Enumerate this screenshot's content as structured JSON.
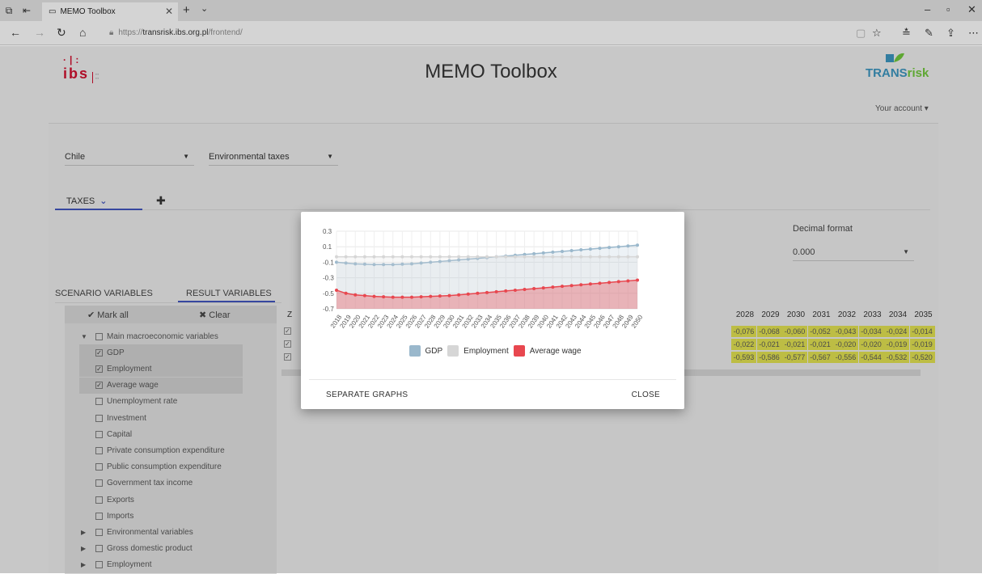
{
  "browser": {
    "tab_title": "MEMO Toolbox",
    "url_prefix": "https://",
    "url_host": "transrisk.ibs.org.pl",
    "url_path": "/frontend/"
  },
  "header": {
    "app_title": "MEMO Toolbox",
    "ibs_logo_text": "ibs",
    "trans_logo_left": "TRANS",
    "trans_logo_right": "risk",
    "account_label": "Your account ▾"
  },
  "filters": {
    "country": "Chile",
    "policy": "Environmental taxes"
  },
  "scenario_tabs": {
    "active_tab": "TAXES",
    "add_symbol": "✚"
  },
  "decimal_format": {
    "label": "Decimal format",
    "value": "0.000"
  },
  "variable_tabs": {
    "scenario": "SCENARIO VARIABLES",
    "result": "RESULT VARIABLES"
  },
  "tree": {
    "mark_all": "✔ Mark all",
    "clear": "✖ Clear",
    "items": [
      {
        "label": "Main macroeconomic variables",
        "checked": false,
        "expanded": true,
        "level": 0
      },
      {
        "label": "GDP",
        "checked": true,
        "level": 1
      },
      {
        "label": "Employment",
        "checked": true,
        "level": 1
      },
      {
        "label": "Average wage",
        "checked": true,
        "level": 1
      },
      {
        "label": "Unemployment rate",
        "checked": false,
        "level": 1
      },
      {
        "label": "Investment",
        "checked": false,
        "level": 1
      },
      {
        "label": "Capital",
        "checked": false,
        "level": 1
      },
      {
        "label": "Private consumption expenditure",
        "checked": false,
        "level": 1
      },
      {
        "label": "Public consumption expenditure",
        "checked": false,
        "level": 1
      },
      {
        "label": "Government tax income",
        "checked": false,
        "level": 1
      },
      {
        "label": "Exports",
        "checked": false,
        "level": 1
      },
      {
        "label": "Imports",
        "checked": false,
        "level": 1
      },
      {
        "label": "Environmental variables",
        "checked": false,
        "expanded": false,
        "level": 0
      },
      {
        "label": "Gross domestic product",
        "checked": false,
        "expanded": false,
        "level": 0
      },
      {
        "label": "Employment",
        "checked": false,
        "expanded": false,
        "level": 0
      }
    ]
  },
  "table": {
    "first_col_header": "Z",
    "years": [
      "2028",
      "2029",
      "2030",
      "2031",
      "2032",
      "2033",
      "2034",
      "2035"
    ],
    "rows": [
      [
        "-0,076",
        "-0,068",
        "-0,060",
        "-0,052",
        "-0,043",
        "-0,034",
        "-0,024",
        "-0,014"
      ],
      [
        "-0,022",
        "-0,021",
        "-0,021",
        "-0,021",
        "-0,020",
        "-0,020",
        "-0,019",
        "-0,019"
      ],
      [
        "-0,593",
        "-0,586",
        "-0,577",
        "-0,567",
        "-0,556",
        "-0,544",
        "-0,532",
        "-0,520"
      ]
    ]
  },
  "modal": {
    "separate_graphs": "SEPARATE GRAPHS",
    "close": "CLOSE"
  },
  "chart_data": {
    "type": "area",
    "x": [
      "2018",
      "2019",
      "2020",
      "2021",
      "2022",
      "2023",
      "2024",
      "2025",
      "2026",
      "2027",
      "2028",
      "2029",
      "2030",
      "2031",
      "2032",
      "2033",
      "2034",
      "2035",
      "2036",
      "2037",
      "2038",
      "2039",
      "2040",
      "2041",
      "2042",
      "2043",
      "2044",
      "2045",
      "2046",
      "2047",
      "2048",
      "2049",
      "2050"
    ],
    "ylim": [
      -0.7,
      0.3
    ],
    "yticks": [
      "0.3",
      "0.1",
      "-0.1",
      "-0.3",
      "-0.5",
      "-0.7"
    ],
    "grid": true,
    "series": [
      {
        "name": "GDP",
        "color": "#9ab8cc",
        "values": [
          -0.1,
          -0.11,
          -0.12,
          -0.125,
          -0.13,
          -0.13,
          -0.13,
          -0.125,
          -0.12,
          -0.11,
          -0.1,
          -0.09,
          -0.08,
          -0.07,
          -0.06,
          -0.05,
          -0.04,
          -0.03,
          -0.02,
          -0.01,
          0.0,
          0.01,
          0.02,
          0.03,
          0.04,
          0.05,
          0.06,
          0.07,
          0.08,
          0.09,
          0.1,
          0.11,
          0.12
        ]
      },
      {
        "name": "Employment",
        "color": "#d6d6d6",
        "values": [
          -0.03,
          -0.03,
          -0.03,
          -0.03,
          -0.03,
          -0.03,
          -0.03,
          -0.03,
          -0.03,
          -0.03,
          -0.03,
          -0.03,
          -0.03,
          -0.03,
          -0.03,
          -0.03,
          -0.03,
          -0.03,
          -0.03,
          -0.03,
          -0.03,
          -0.03,
          -0.03,
          -0.03,
          -0.03,
          -0.03,
          -0.03,
          -0.03,
          -0.03,
          -0.03,
          -0.03,
          -0.03,
          -0.03
        ]
      },
      {
        "name": "Average wage",
        "color": "#e8474f",
        "values": [
          -0.46,
          -0.5,
          -0.52,
          -0.53,
          -0.54,
          -0.545,
          -0.55,
          -0.55,
          -0.55,
          -0.545,
          -0.54,
          -0.535,
          -0.53,
          -0.52,
          -0.51,
          -0.5,
          -0.49,
          -0.48,
          -0.47,
          -0.46,
          -0.45,
          -0.44,
          -0.43,
          -0.42,
          -0.41,
          -0.4,
          -0.39,
          -0.38,
          -0.37,
          -0.36,
          -0.35,
          -0.34,
          -0.33
        ]
      }
    ]
  }
}
